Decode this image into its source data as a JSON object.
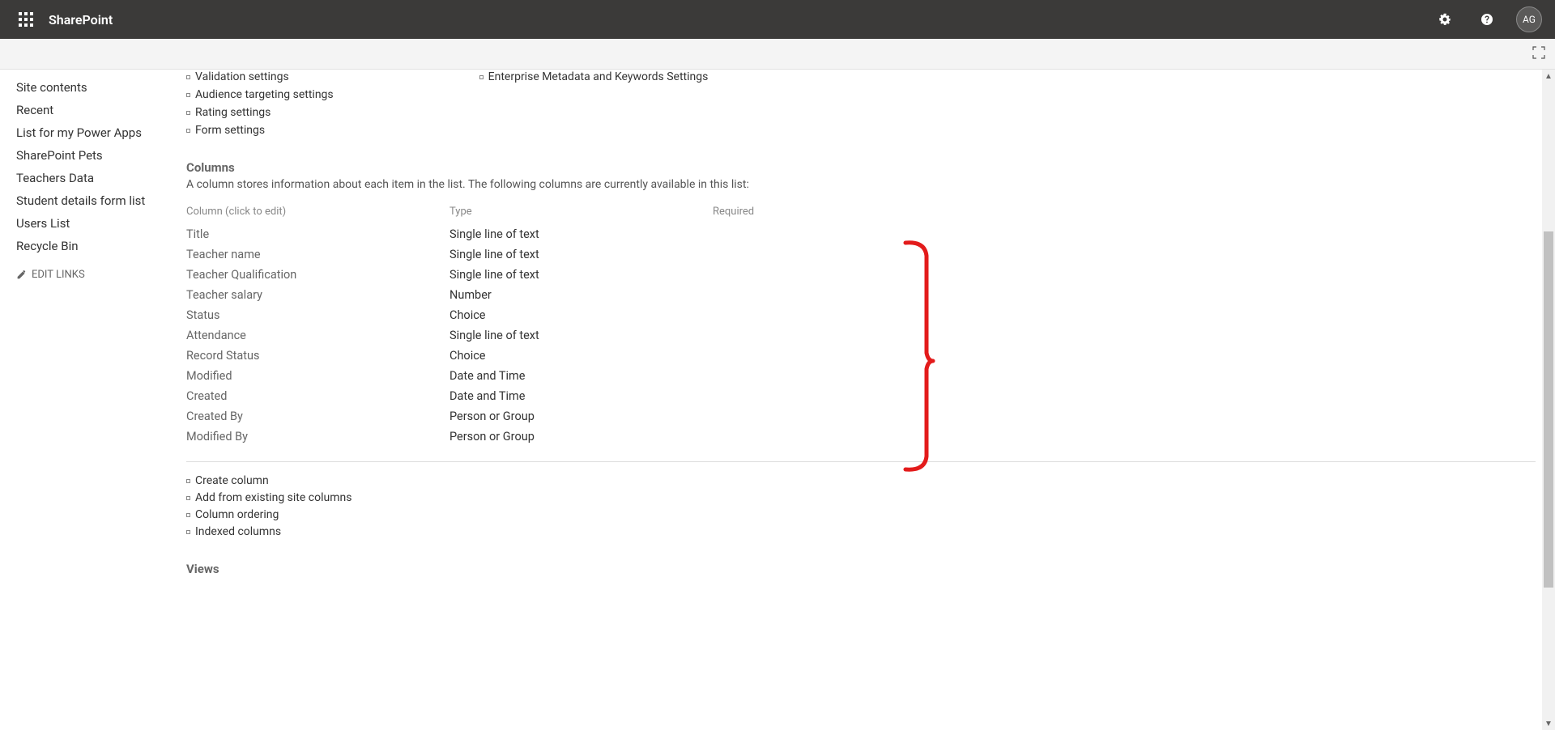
{
  "header": {
    "app_name": "SharePoint",
    "avatar_initials": "AG"
  },
  "sidebar": {
    "items": [
      "Site contents",
      "Recent",
      "List for my Power Apps",
      "SharePoint Pets",
      "Teachers Data",
      "Student details form list",
      "Users List",
      "Recycle Bin"
    ],
    "edit_links_label": "EDIT LINKS"
  },
  "general_settings": {
    "left_links": [
      "Validation settings",
      "Audience targeting settings",
      "Rating settings",
      "Form settings"
    ],
    "right_links": [
      "Enterprise Metadata and Keywords Settings"
    ]
  },
  "columns_section": {
    "heading": "Columns",
    "description": "A column stores information about each item in the list. The following columns are currently available in this list:",
    "headers": {
      "name": "Column (click to edit)",
      "type": "Type",
      "required": "Required"
    },
    "rows": [
      {
        "name": "Title",
        "type": "Single line of text",
        "required": ""
      },
      {
        "name": "Teacher name",
        "type": "Single line of text",
        "required": ""
      },
      {
        "name": "Teacher Qualification",
        "type": "Single line of text",
        "required": ""
      },
      {
        "name": "Teacher salary",
        "type": "Number",
        "required": ""
      },
      {
        "name": "Status",
        "type": "Choice",
        "required": ""
      },
      {
        "name": "Attendance",
        "type": "Single line of text",
        "required": ""
      },
      {
        "name": "Record Status",
        "type": "Choice",
        "required": ""
      },
      {
        "name": "Modified",
        "type": "Date and Time",
        "required": ""
      },
      {
        "name": "Created",
        "type": "Date and Time",
        "required": ""
      },
      {
        "name": "Created By",
        "type": "Person or Group",
        "required": ""
      },
      {
        "name": "Modified By",
        "type": "Person or Group",
        "required": ""
      }
    ],
    "actions": [
      "Create column",
      "Add from existing site columns",
      "Column ordering",
      "Indexed columns"
    ]
  },
  "views_section": {
    "heading": "Views"
  }
}
